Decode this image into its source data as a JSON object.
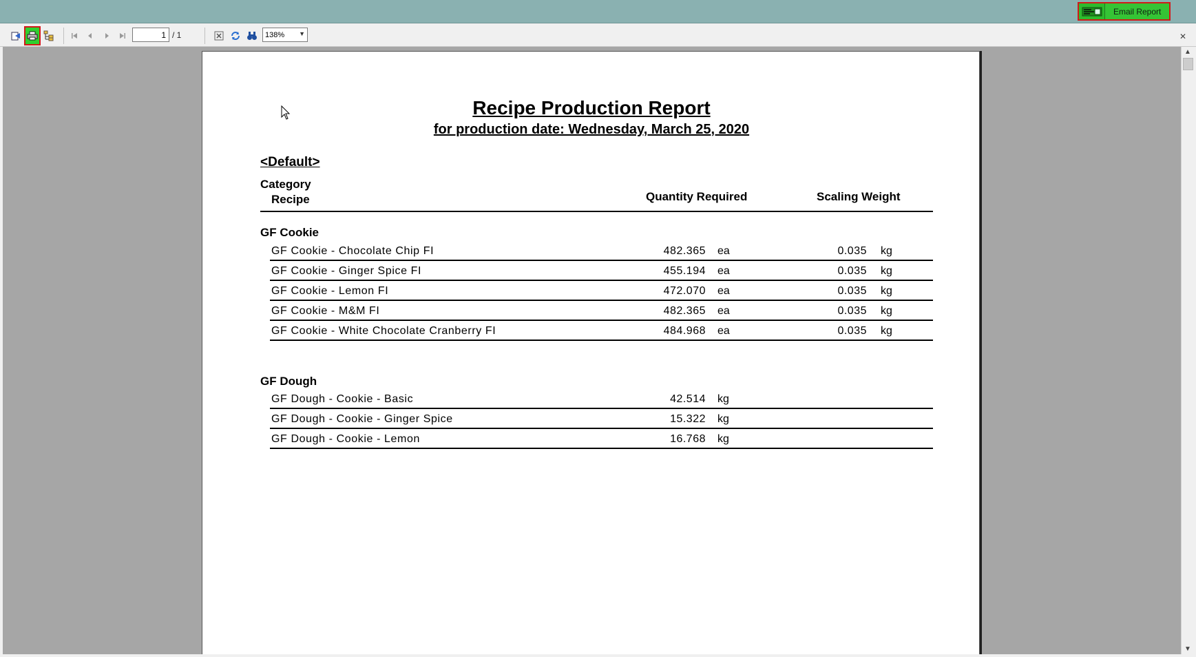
{
  "topbar": {
    "email_label": "Email Report"
  },
  "toolbar": {
    "page_current": "1",
    "page_total": "/ 1",
    "zoom": "138%"
  },
  "report": {
    "title": "Recipe Production Report",
    "subtitle": "for production date: Wednesday, March 25, 2020",
    "group": "<Default>",
    "headers": {
      "category": "Category",
      "recipe": "Recipe",
      "quantity": "Quantity Required",
      "scaling": "Scaling Weight"
    },
    "categories": [
      {
        "name": "GF Cookie",
        "rows": [
          {
            "recipe": "GF Cookie - Chocolate Chip FI",
            "qty": "482.365",
            "qty_unit": "ea",
            "weight": "0.035",
            "weight_unit": "kg"
          },
          {
            "recipe": "GF Cookie - Ginger Spice FI",
            "qty": "455.194",
            "qty_unit": "ea",
            "weight": "0.035",
            "weight_unit": "kg"
          },
          {
            "recipe": "GF Cookie - Lemon FI",
            "qty": "472.070",
            "qty_unit": "ea",
            "weight": "0.035",
            "weight_unit": "kg"
          },
          {
            "recipe": "GF Cookie - M&M FI",
            "qty": "482.365",
            "qty_unit": "ea",
            "weight": "0.035",
            "weight_unit": "kg"
          },
          {
            "recipe": "GF Cookie - White Chocolate Cranberry FI",
            "qty": "484.968",
            "qty_unit": "ea",
            "weight": "0.035",
            "weight_unit": "kg"
          }
        ]
      },
      {
        "name": "GF Dough",
        "rows": [
          {
            "recipe": "GF Dough - Cookie - Basic",
            "qty": "42.514",
            "qty_unit": "kg",
            "weight": "",
            "weight_unit": ""
          },
          {
            "recipe": "GF Dough - Cookie - Ginger Spice",
            "qty": "15.322",
            "qty_unit": "kg",
            "weight": "",
            "weight_unit": ""
          },
          {
            "recipe": "GF Dough - Cookie - Lemon",
            "qty": "16.768",
            "qty_unit": "kg",
            "weight": "",
            "weight_unit": ""
          }
        ]
      }
    ]
  }
}
